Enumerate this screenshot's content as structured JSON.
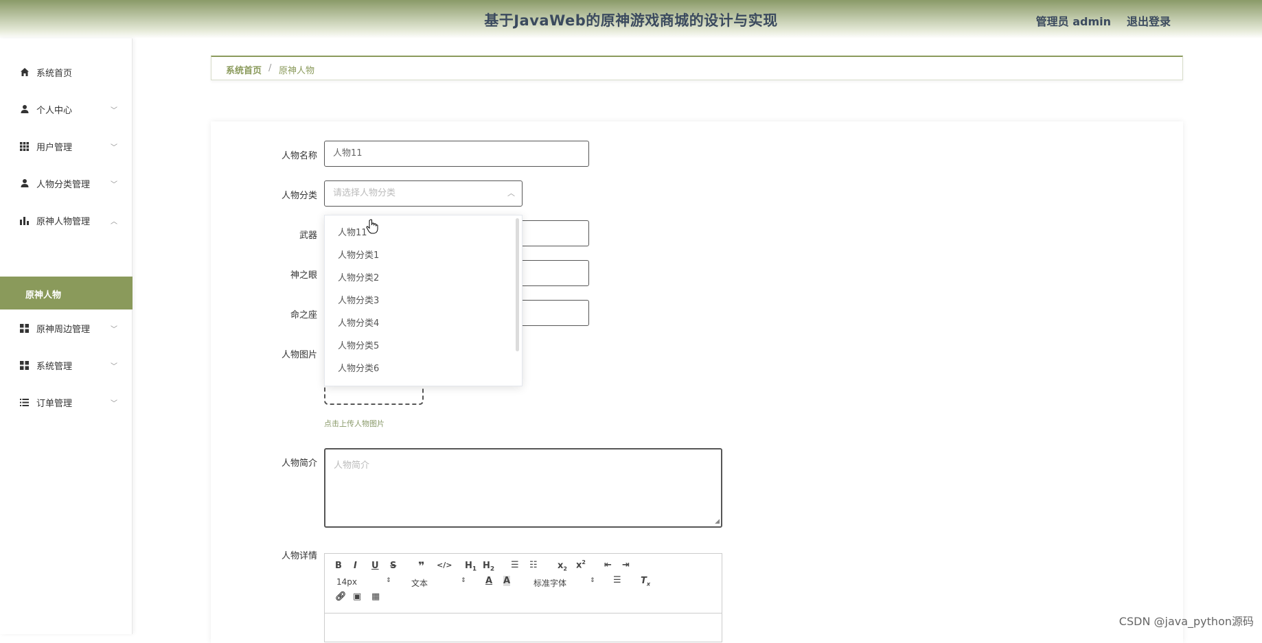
{
  "header": {
    "title": "基于JavaWeb的原神游戏商城的设计与实现",
    "user": "管理员 admin",
    "logout": "退出登录"
  },
  "sidebar": {
    "items": [
      {
        "label": "系统首页",
        "icon": "home-icon"
      },
      {
        "label": "个人中心",
        "icon": "person-icon"
      },
      {
        "label": "用户管理",
        "icon": "grid-icon"
      },
      {
        "label": "人物分类管理",
        "icon": "person-icon"
      },
      {
        "label": "原神人物管理",
        "icon": "bar-chart-icon"
      },
      {
        "label": "原神周边管理",
        "icon": "apps-icon"
      },
      {
        "label": "系统管理",
        "icon": "apps-icon"
      },
      {
        "label": "订单管理",
        "icon": "list-icon"
      }
    ],
    "active_sub": "原神人物"
  },
  "breadcrumb": {
    "home": "系统首页",
    "separator": "/",
    "current": "原神人物"
  },
  "form": {
    "name_label": "人物名称",
    "name_value": "人物11",
    "category_label": "人物分类",
    "category_placeholder": "请选择人物分类",
    "weapon_label": "武器",
    "eye_label": "神之眼",
    "constellation_label": "命之座",
    "image_label": "人物图片",
    "upload_tip": "点击上传人物图片",
    "intro_label": "人物简介",
    "intro_placeholder": "人物简介",
    "detail_label": "人物详情"
  },
  "dropdown": {
    "options": [
      "人物11",
      "人物分类1",
      "人物分类2",
      "人物分类3",
      "人物分类4",
      "人物分类5",
      "人物分类6"
    ]
  },
  "editor": {
    "font_size": "14px",
    "text_style": "文本",
    "font_family": "标准字体"
  },
  "watermark": "CSDN @java_python源码",
  "colors": {
    "accent": "#8a9a5b",
    "header_text": "#3b4a5e"
  }
}
